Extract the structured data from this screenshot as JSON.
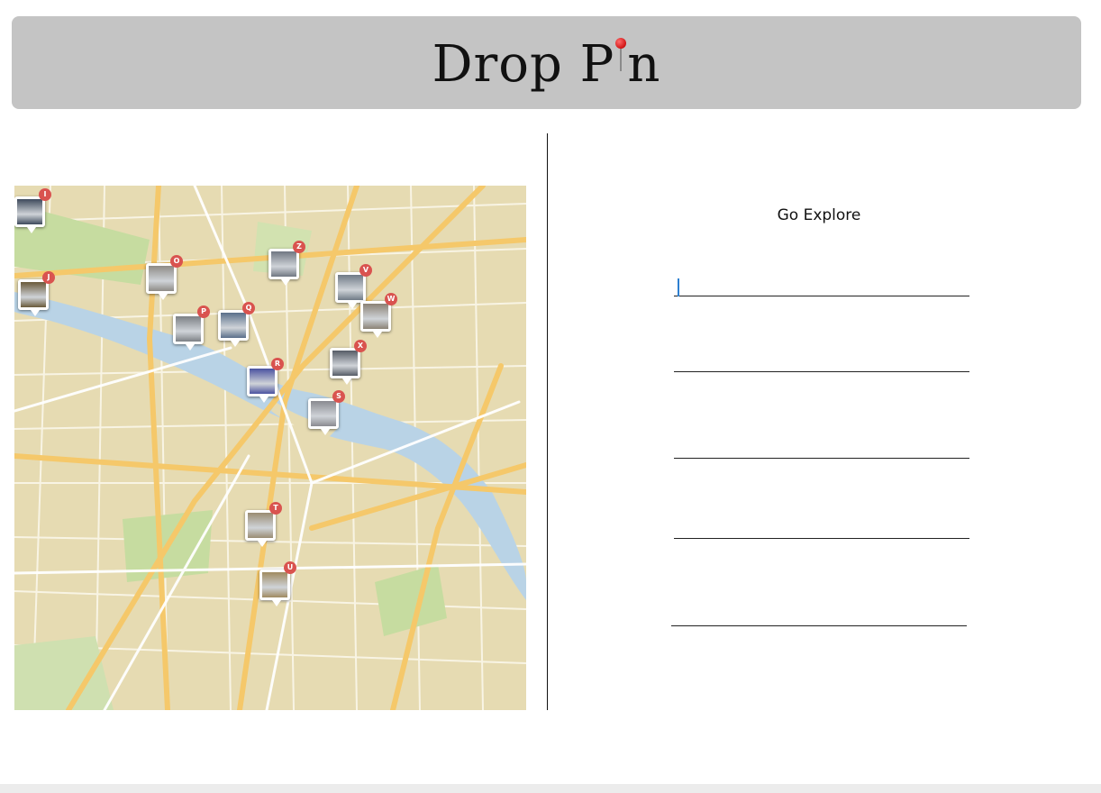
{
  "header": {
    "logo_part1": "Drop P",
    "logo_part2": "n",
    "pin_color": "#d01414"
  },
  "map": {
    "markers": [
      {
        "letter": "I",
        "color": "#3e4a5c"
      },
      {
        "letter": "J",
        "color": "#6a5a3a"
      },
      {
        "letter": "O",
        "color": "#8e8b86"
      },
      {
        "letter": "P",
        "color": "#7c8085"
      },
      {
        "letter": "Q",
        "color": "#5a6f8a"
      },
      {
        "letter": "R",
        "color": "#4a52a0"
      },
      {
        "letter": "Z",
        "color": "#707782"
      },
      {
        "letter": "V",
        "color": "#6f7a86"
      },
      {
        "letter": "W",
        "color": "#8b8275"
      },
      {
        "letter": "X",
        "color": "#565c66"
      },
      {
        "letter": "S",
        "color": "#8a8a90"
      },
      {
        "letter": "T",
        "color": "#9a8c72"
      },
      {
        "letter": "U",
        "color": "#a08a60"
      }
    ],
    "badge_color": "#d9534f",
    "water_color": "#b9d3e6",
    "park_color": "#c6dca0",
    "road_color": "#f5c86a"
  },
  "explore": {
    "title": "Go Explore",
    "fields": [
      {
        "value": "",
        "placeholder": ""
      },
      {
        "value": "",
        "placeholder": ""
      },
      {
        "value": "",
        "placeholder": ""
      },
      {
        "value": "",
        "placeholder": ""
      },
      {
        "value": "",
        "placeholder": ""
      }
    ]
  }
}
